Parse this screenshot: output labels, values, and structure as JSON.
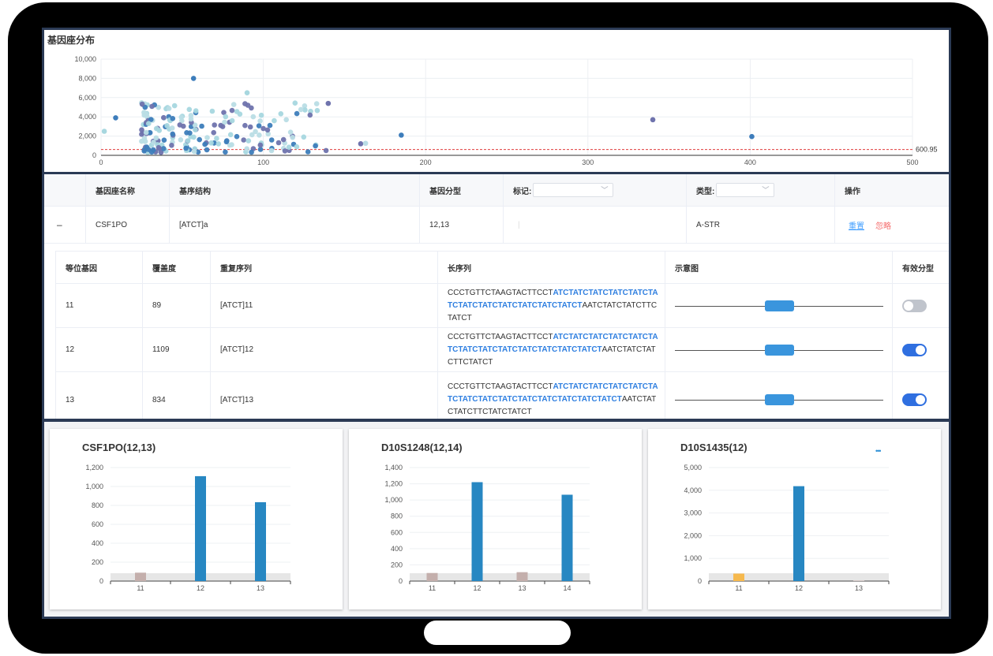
{
  "scatter_panel": {
    "title": "基因座分布",
    "threshold_label": "600.95",
    "y_ticks": [
      "10,000",
      "8,000",
      "6,000",
      "4,000",
      "2,000",
      "0"
    ],
    "x_ticks": [
      "0",
      "100",
      "200",
      "300",
      "400",
      "500"
    ]
  },
  "table": {
    "headers": {
      "name": "基因座名称",
      "structure": "基序结构",
      "genotype": "基因分型",
      "mark": "标记:",
      "type": "类型:",
      "action": "操作"
    },
    "row": {
      "expand_icon": "–",
      "name": "CSF1PO",
      "structure": "[ATCT]a",
      "genotype": "12,13",
      "mark_value": "|",
      "type": "A-STR",
      "reset": "重置",
      "ignore": "忽略"
    },
    "sub_headers": {
      "allele": "等位基因",
      "coverage": "覆盖度",
      "repeat": "重复序列",
      "long": "长序列",
      "diagram": "示意图",
      "valid": "有效分型"
    },
    "sub_rows": [
      {
        "allele": "11",
        "coverage": "89",
        "repeat": "[ATCT]11",
        "seq_pre": "CCCTGTTCTAAGTACTTCCT",
        "seq_hl": "ATCTATCTATCTATCTATCTATCTATCTATCTATCTATCTATCTATCT",
        "seq_post": "AATCTATCTATCTTCTATCT",
        "valid": false
      },
      {
        "allele": "12",
        "coverage": "1109",
        "repeat": "[ATCT]12",
        "seq_pre": "CCCTGTTCTAAGTACTTCCT",
        "seq_hl": "ATCTATCTATCTATCTATCTATCTATCTATCTATCTATCTATCTATCTATCT",
        "seq_post": "AATCTATCTATCTTCTATCT",
        "valid": true
      },
      {
        "allele": "13",
        "coverage": "834",
        "repeat": "[ATCT]13",
        "seq_pre": "CCCTGTTCTAAGTACTTCCT",
        "seq_hl": "ATCTATCTATCTATCTATCTATCTATCTATCTATCTATCTATCTATCTATCTATCT",
        "seq_post": "AATCTATCTATCTTCTATCTATCT",
        "valid": true
      }
    ]
  },
  "colors": {
    "bar_main": "#2787c2",
    "bar_noise": "#c4afac",
    "bar_orange": "#f6b94e",
    "accent": "#409eff",
    "danger": "#f56c6c"
  },
  "chart_data": [
    {
      "type": "bar",
      "title": "CSF1PO(12,13)",
      "categories": [
        "11",
        "12",
        "13"
      ],
      "values": [
        89,
        1109,
        834
      ],
      "ylim": [
        0,
        1200
      ],
      "y_ticks": [
        "0",
        "200",
        "400",
        "600",
        "800",
        "1,000",
        "1,200"
      ],
      "bar_colors": [
        "#c4afac",
        "#2787c2",
        "#2787c2"
      ]
    },
    {
      "type": "bar",
      "title": "D10S1248(12,14)",
      "categories": [
        "11",
        "12",
        "13",
        "14"
      ],
      "values": [
        100,
        1220,
        110,
        1065
      ],
      "ylim": [
        0,
        1400
      ],
      "y_ticks": [
        "0",
        "200",
        "400",
        "600",
        "800",
        "1,000",
        "1,200",
        "1,400"
      ],
      "bar_colors": [
        "#c4afac",
        "#2787c2",
        "#c4afac",
        "#2787c2"
      ]
    },
    {
      "type": "bar",
      "title": "D10S1435(12)",
      "categories": [
        "11",
        "12",
        "13"
      ],
      "values": [
        330,
        4180,
        20
      ],
      "ylim": [
        0,
        5000
      ],
      "y_ticks": [
        "0",
        "1,000",
        "2,000",
        "3,000",
        "4,000",
        "5,000"
      ],
      "bar_colors": [
        "#f6b94e",
        "#2787c2",
        "#c4afac"
      ],
      "more_icon": "•••"
    }
  ]
}
